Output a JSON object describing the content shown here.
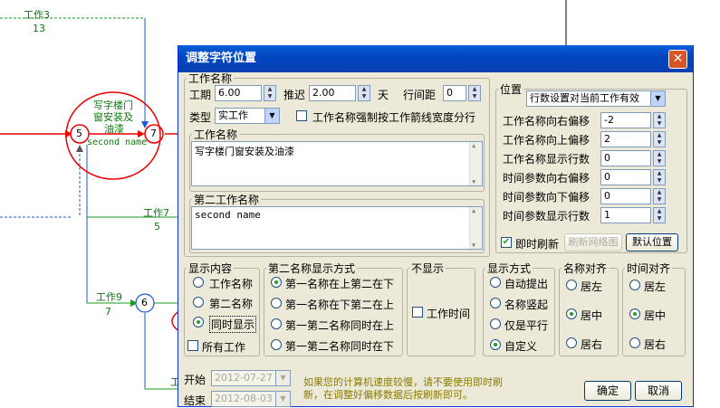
{
  "background": {
    "act_labels": {
      "work3": "工作3",
      "work3_dur": "13",
      "work7": "工作7",
      "work7_dur": "5",
      "work9": "工作9",
      "work9_dur": "7",
      "partial": "工"
    },
    "node_5": "5",
    "node_7": "7",
    "node_6": "6",
    "node_text_name": "写字楼门窗安装及油漆",
    "node_text_line1": "写字楼门",
    "node_text_line2": "窗安装及",
    "node_text_line3": "油漆",
    "node_text_second": "second name"
  },
  "dialog": {
    "title": "调整字符位置",
    "work_name_group": "工作名称",
    "duration_label": "工期",
    "duration_value": "6.00",
    "delay_label": "推迟",
    "delay_value": "2.00",
    "day_unit": "天",
    "line_spacing_label": "行间距",
    "line_spacing_value": "0",
    "type_label": "类型",
    "type_value": "实工作",
    "force_width_label": "工作名称强制按工作箭线宽度分行",
    "name_sub_label": "工作名称",
    "name_text": "写字楼门窗安装及油漆",
    "second_name_label": "第二工作名称",
    "second_name_text": "second name",
    "position_group": "位置",
    "position_select": "行数设置对当前工作有效",
    "offset_rows": [
      {
        "label": "工作名称向右偏移",
        "value": "-2"
      },
      {
        "label": "工作名称向上偏移",
        "value": "2"
      },
      {
        "label": "工作名称显示行数",
        "value": "0"
      },
      {
        "label": "时间参数向右偏移",
        "value": "0"
      },
      {
        "label": "时间参数向下偏移",
        "value": "0"
      },
      {
        "label": "时间参数显示行数",
        "value": "1"
      }
    ],
    "instant_refresh_label": "即时刷新",
    "refresh_network_btn": "刷新网络图",
    "default_pos_btn": "默认位置",
    "display_content": {
      "title": "显示内容",
      "opt1": "工作名称",
      "opt2": "第二名称",
      "opt3": "同时显示",
      "all_works": "所有工作"
    },
    "second_mode": {
      "title": "第二名称显示方式",
      "opt1": "第一名称在上第二在下",
      "opt2": "第一名称在下第二在上",
      "opt3": "第一第二名称同时在上",
      "opt4": "第一第二名称同时在下"
    },
    "no_show": {
      "title": "不显示",
      "opt1": "工作时间"
    },
    "show_mode": {
      "title": "显示方式",
      "opt1": "自动提出",
      "opt2": "名称竖起",
      "opt3": "仅是平行",
      "opt4": "自定义"
    },
    "name_align": {
      "title": "名称对齐",
      "opt1": "居左",
      "opt2": "居中",
      "opt3": "居右"
    },
    "time_align": {
      "title": "时间对齐",
      "opt1": "居左",
      "opt2": "居中",
      "opt3": "居右"
    },
    "start_label": "开始",
    "start_value": "2012-07-27",
    "end_label": "结束",
    "end_value": "2012-08-03",
    "note_line1": "如果您的计算机速度较慢，请不要使用即时刷",
    "note_line2": "新，在调整好偏移数据后按刷新即可。",
    "ok_btn": "确定",
    "cancel_btn": "取消"
  }
}
